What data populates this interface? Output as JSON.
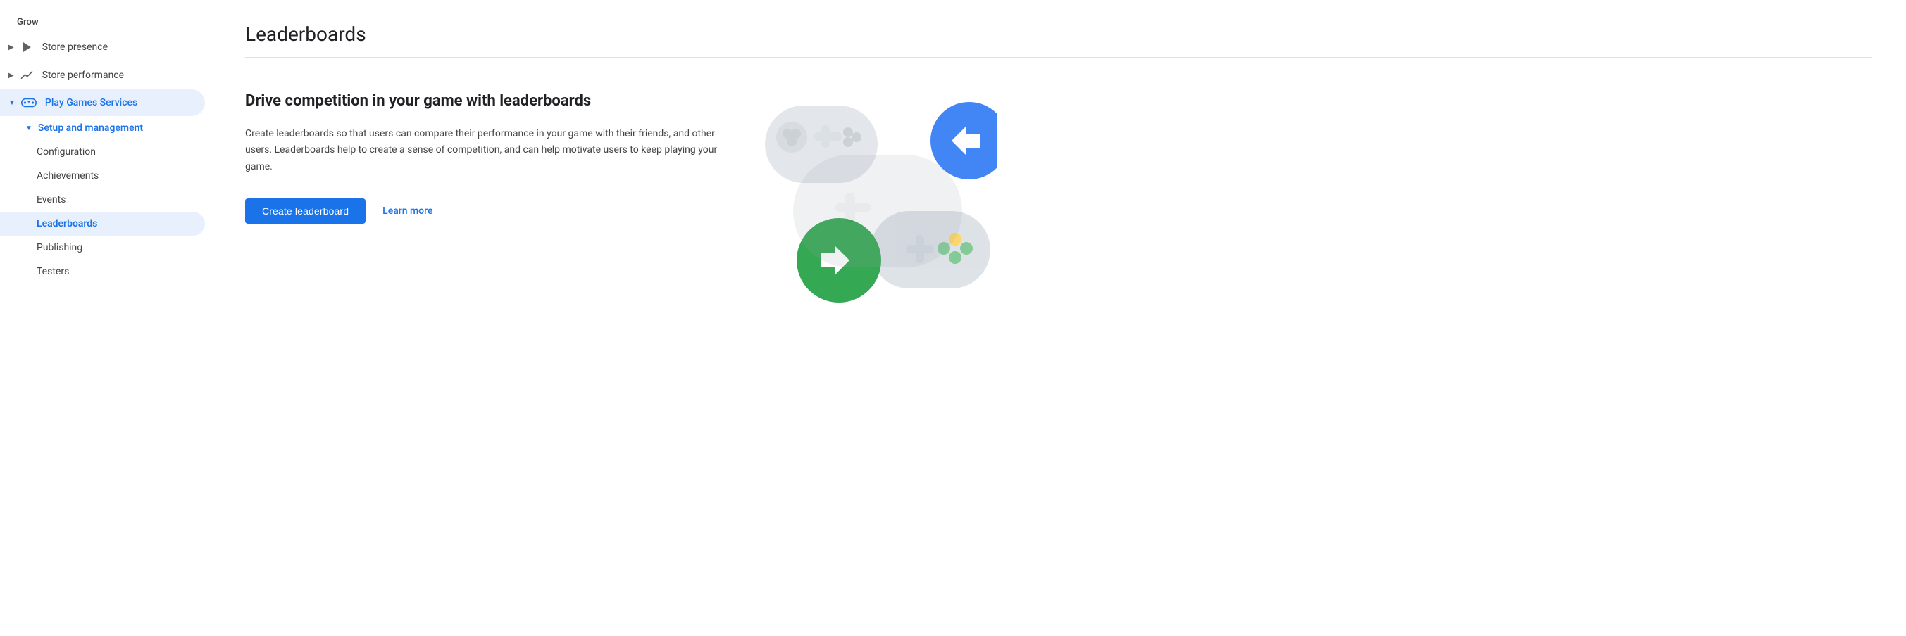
{
  "sidebar": {
    "grow_label": "Grow",
    "items": [
      {
        "id": "store-presence",
        "label": "Store presence",
        "icon": "play-icon",
        "expandable": true,
        "expanded": false
      },
      {
        "id": "store-performance",
        "label": "Store performance",
        "icon": "chart-icon",
        "expandable": true,
        "expanded": false
      },
      {
        "id": "play-games-services",
        "label": "Play Games Services",
        "icon": "gamepad-icon",
        "expandable": true,
        "expanded": true,
        "active": true
      }
    ],
    "subitems": {
      "play-games-services": {
        "subsection": "Setup and management",
        "children": [
          {
            "id": "configuration",
            "label": "Configuration",
            "active": false
          },
          {
            "id": "achievements",
            "label": "Achievements",
            "active": false
          },
          {
            "id": "events",
            "label": "Events",
            "active": false
          },
          {
            "id": "leaderboards",
            "label": "Leaderboards",
            "active": true
          },
          {
            "id": "publishing",
            "label": "Publishing",
            "active": false
          },
          {
            "id": "testers",
            "label": "Testers",
            "active": false
          }
        ]
      }
    }
  },
  "main": {
    "page_title": "Leaderboards",
    "content_heading": "Drive competition in your game with leaderboards",
    "content_body": "Create leaderboards so that users can compare their performance in your game with their friends, and other users. Leaderboards help to create a sense of competition, and can help motivate users to keep playing your game.",
    "btn_create_label": "Create leaderboard",
    "link_learn_more_label": "Learn more"
  }
}
